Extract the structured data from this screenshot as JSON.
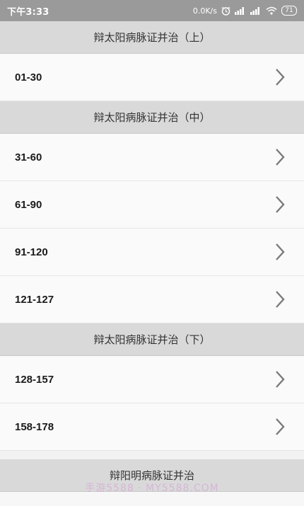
{
  "status_bar": {
    "time": "下午3:33",
    "speed": "0.0K/s",
    "battery": "71"
  },
  "sections": [
    {
      "title": "辩太阳病脉证并治（上）",
      "items": [
        {
          "label": "01-30"
        }
      ]
    },
    {
      "title": "辩太阳病脉证并治（中）",
      "items": [
        {
          "label": "31-60"
        },
        {
          "label": "61-90"
        },
        {
          "label": "91-120"
        },
        {
          "label": "121-127"
        }
      ]
    },
    {
      "title": "辩太阳病脉证并治（下）",
      "items": [
        {
          "label": "128-157"
        },
        {
          "label": "158-178"
        }
      ]
    },
    {
      "title": "辩阳明病脉证并治",
      "items": []
    }
  ],
  "watermark": "手游5588 · MY5588.COM",
  "colors": {
    "status_bar": "#9a9a9a",
    "header_bg": "#d9d9d9",
    "item_bg": "#fafafa",
    "chevron": "#7a7a7a"
  }
}
